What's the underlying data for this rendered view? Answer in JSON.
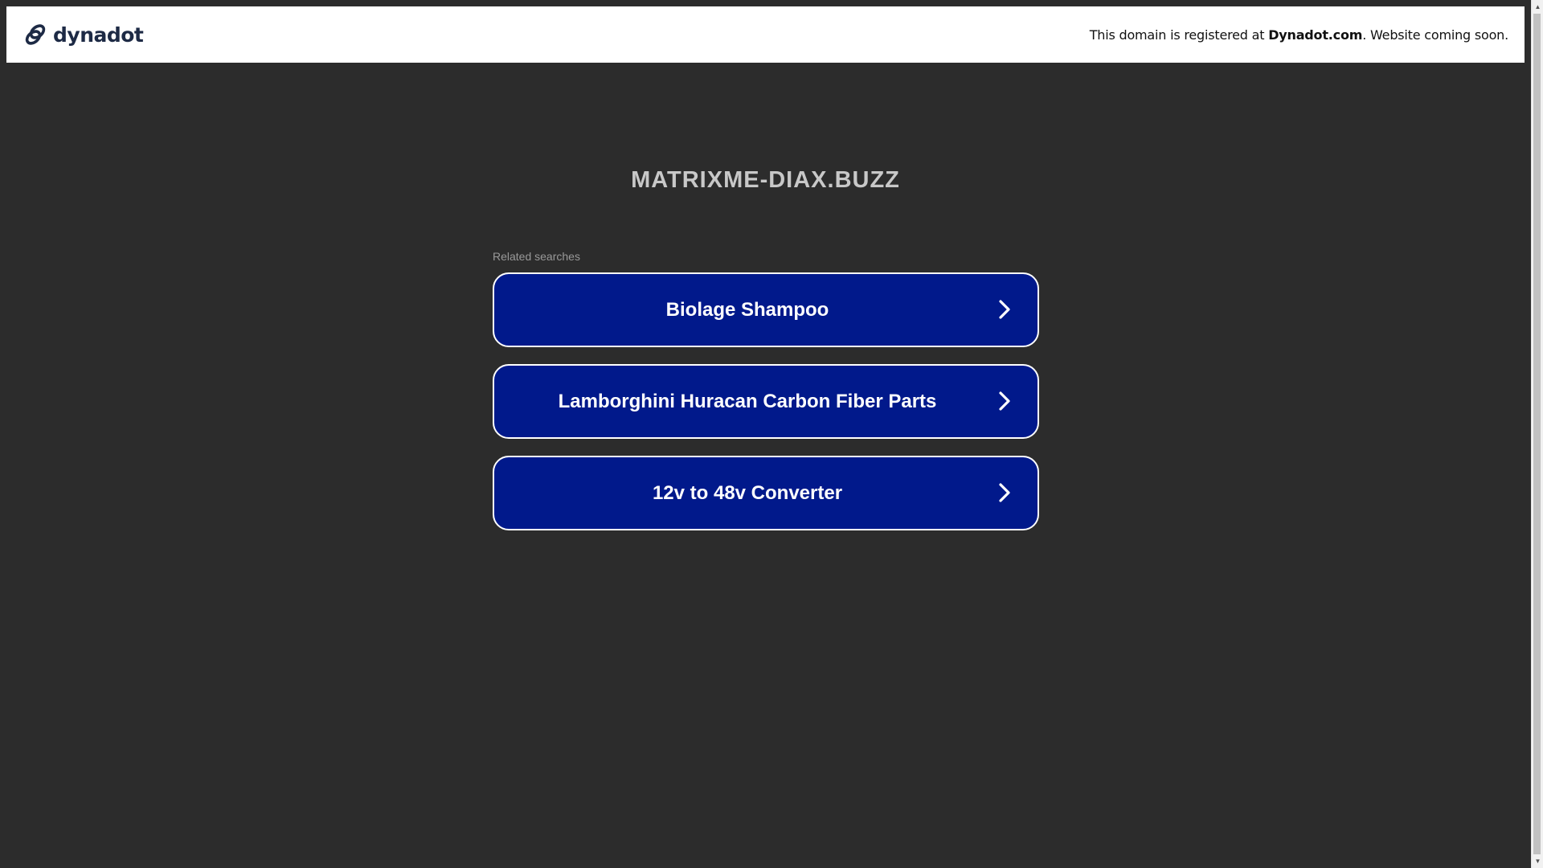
{
  "banner": {
    "logo_text": "dynadot",
    "message_prefix": "This domain is registered at ",
    "message_brand": "Dynadot.com",
    "message_suffix": ". Website coming soon."
  },
  "main": {
    "domain": "MATRIXME-DIAX.BUZZ",
    "related_label": "Related searches",
    "links": [
      {
        "label": "Biolage Shampoo"
      },
      {
        "label": "Lamborghini Huracan Carbon Fiber Parts"
      },
      {
        "label": "12v to 48v Converter"
      }
    ]
  },
  "colors": {
    "background": "#2c2c2c",
    "button": "#01198b",
    "logo": "#1d2a45"
  },
  "icons": {
    "logo": "dynadot-link-icon",
    "link_arrow": "chevron-right-icon"
  }
}
